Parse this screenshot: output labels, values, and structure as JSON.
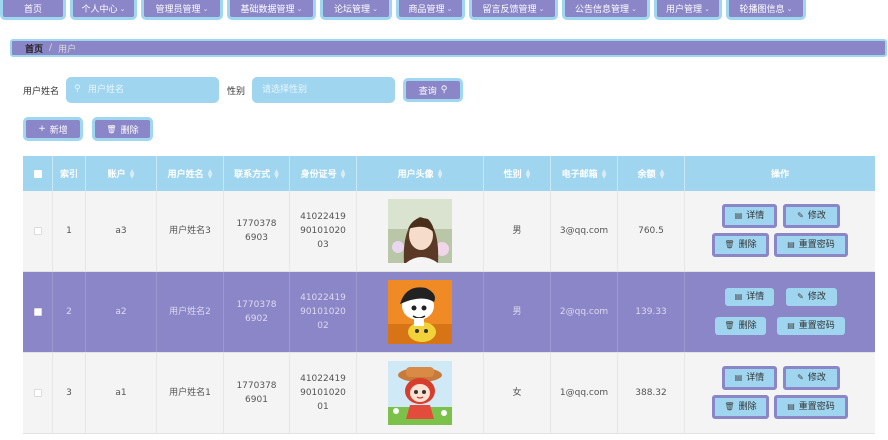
{
  "nav": {
    "items": [
      {
        "label": "首页",
        "dropdown": false
      },
      {
        "label": "个人中心",
        "dropdown": true
      },
      {
        "label": "管理员管理",
        "dropdown": true
      },
      {
        "label": "基础数据管理",
        "dropdown": true
      },
      {
        "label": "论坛管理",
        "dropdown": true
      },
      {
        "label": "商品管理",
        "dropdown": true
      },
      {
        "label": "留言反馈管理",
        "dropdown": true
      },
      {
        "label": "公告信息管理",
        "dropdown": true
      },
      {
        "label": "用户管理",
        "dropdown": true
      },
      {
        "label": "轮播图信息",
        "dropdown": true
      }
    ]
  },
  "breadcrumb": {
    "home": "首页",
    "separator": "/",
    "current": "用户"
  },
  "search": {
    "name_label": "用户姓名",
    "name_placeholder": "用户姓名",
    "gender_label": "性别",
    "gender_placeholder": "请选择性别",
    "query_label": "查询"
  },
  "actions": {
    "add_label": "新增",
    "delete_label": "删除"
  },
  "table": {
    "headers": [
      "",
      "索引",
      "账户",
      "用户姓名",
      "联系方式",
      "身份证号",
      "用户头像",
      "性别",
      "电子邮箱",
      "余额",
      "操作"
    ],
    "rows": [
      {
        "index": "1",
        "account": "a3",
        "name": "用户姓名3",
        "phone": "17703786903",
        "idcard": "410224199010102003",
        "gender": "男",
        "email": "3@qq.com",
        "balance": "760.5",
        "avatar": "photo-girl-icon"
      },
      {
        "index": "2",
        "account": "a2",
        "name": "用户姓名2",
        "phone": "17703786902",
        "idcard": "410224199010102002",
        "gender": "男",
        "email": "2@qq.com",
        "balance": "139.33",
        "avatar": "cartoon-boy-icon"
      },
      {
        "index": "3",
        "account": "a1",
        "name": "用户姓名1",
        "phone": "17703786901",
        "idcard": "410224199010102001",
        "gender": "女",
        "email": "1@qq.com",
        "balance": "388.32",
        "avatar": "cartoon-girl-icon"
      }
    ],
    "op_labels": {
      "detail": "详情",
      "edit": "修改",
      "delete": "删除",
      "reset": "重置密码"
    }
  },
  "colors": {
    "purple": "#8b86c7",
    "blue": "#9fd5ef",
    "border_blue": "#9fd7f1"
  }
}
